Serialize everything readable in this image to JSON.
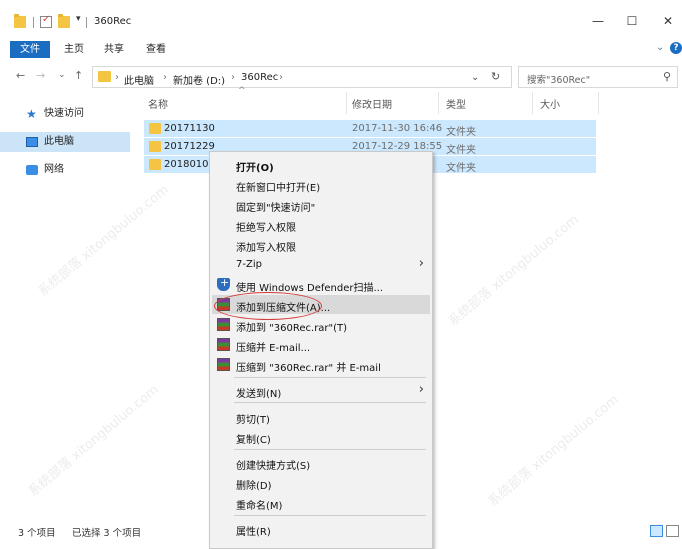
{
  "window": {
    "title": "360Rec",
    "controls": {
      "minimize": "—",
      "maximize": "☐",
      "close": "✕"
    }
  },
  "ribbon": {
    "tabs": [
      "文件",
      "主页",
      "共享",
      "查看"
    ],
    "expand_icon": "⌄",
    "help_icon": "?"
  },
  "address": {
    "back": "←",
    "forward": "→",
    "recent": "⌄",
    "up": "↑",
    "crumbs": [
      "此电脑",
      "新加卷 (D:)",
      "360Rec"
    ],
    "crumb_sep": "›",
    "dropdown": "⌄",
    "refresh": "↻",
    "search_placeholder": "搜索\"360Rec\"",
    "search_icon": "⚲"
  },
  "navpane": {
    "items": [
      {
        "label": "快速访问",
        "icon": "star-icon"
      },
      {
        "label": "此电脑",
        "icon": "computer-icon"
      },
      {
        "label": "网络",
        "icon": "network-icon"
      }
    ]
  },
  "columns": {
    "name": "名称",
    "date": "修改日期",
    "type": "类型",
    "size": "大小",
    "sort_indicator": "^"
  },
  "files": [
    {
      "name": "20171130",
      "date": "2017-11-30 16:46",
      "type": "文件夹"
    },
    {
      "name": "20171229",
      "date": "2017-12-29 18:55",
      "type": "文件夹"
    },
    {
      "name": "20180109",
      "date": "",
      "type": "文件夹"
    }
  ],
  "context_menu": {
    "items": [
      {
        "label": "打开(O)"
      },
      {
        "label": "在新窗口中打开(E)"
      },
      {
        "label": "固定到\"快速访问\""
      },
      {
        "label": "拒绝写入权限"
      },
      {
        "label": "添加写入权限"
      },
      {
        "label": "7-Zip"
      },
      {
        "label": "使用 Windows Defender扫描..."
      },
      {
        "label": "添加到压缩文件(A)..."
      },
      {
        "label": "添加到 \"360Rec.rar\"(T)"
      },
      {
        "label": "压缩并 E-mail..."
      },
      {
        "label": "压缩到 \"360Rec.rar\" 并 E-mail"
      },
      {
        "label": "发送到(N)"
      },
      {
        "label": "剪切(T)"
      },
      {
        "label": "复制(C)"
      },
      {
        "label": "创建快捷方式(S)"
      },
      {
        "label": "删除(D)"
      },
      {
        "label": "重命名(M)"
      },
      {
        "label": "属性(R)"
      }
    ],
    "submenu_arrow": "›"
  },
  "status": {
    "count": "3 个项目",
    "selected": "已选择 3 个项目"
  },
  "watermark": "系统部落 xitongbuluo.com",
  "colors": {
    "accent": "#1b6dc1",
    "selection": "#cce8ff",
    "highlight_oval": "#d43b3b"
  }
}
